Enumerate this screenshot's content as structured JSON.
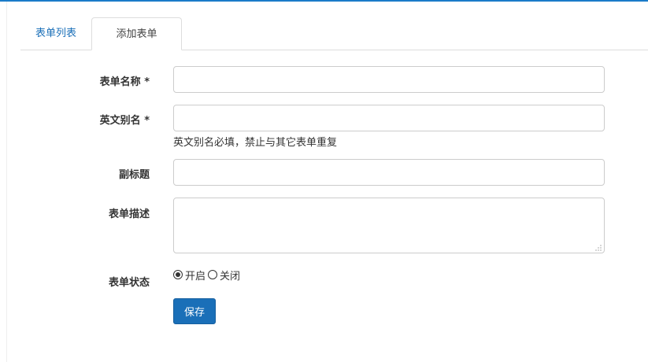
{
  "tabs": [
    {
      "label": "表单列表",
      "active": false
    },
    {
      "label": "添加表单",
      "active": true
    }
  ],
  "form": {
    "name_label": "表单名称 *",
    "name_value": "",
    "alias_label": "英文别名 *",
    "alias_value": "",
    "alias_help": "英文别名必填，禁止与其它表单重复",
    "subtitle_label": "副标题",
    "subtitle_value": "",
    "description_label": "表单描述",
    "description_value": "",
    "status_label": "表单状态",
    "status_options": [
      {
        "label": "开启",
        "checked": true
      },
      {
        "label": "关闭",
        "checked": false
      }
    ],
    "save_label": "保存"
  },
  "colors": {
    "accent": "#1a6fb8",
    "top_bar": "#1a7bc9",
    "border": "#cccccc"
  }
}
